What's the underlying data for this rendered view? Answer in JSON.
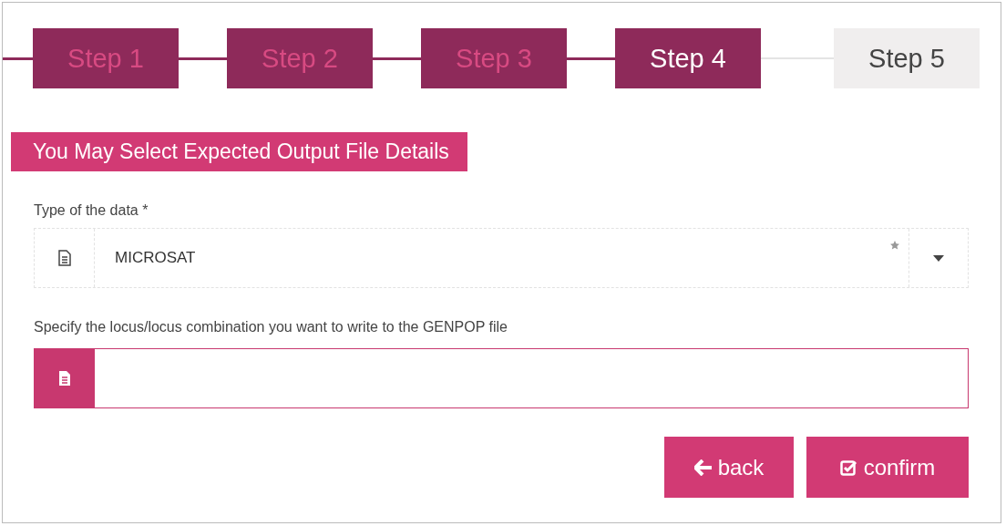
{
  "steps": [
    {
      "label": "Step 1",
      "done": true,
      "selected": false
    },
    {
      "label": "Step 2",
      "done": true,
      "selected": false
    },
    {
      "label": "Step 3",
      "done": true,
      "selected": false
    },
    {
      "label": "Step 4",
      "done": false,
      "selected": true
    },
    {
      "label": "Step 5",
      "done": false,
      "selected": false
    }
  ],
  "section_title": "You May Select Expected Output File Details",
  "data_type": {
    "label": "Type of the data *",
    "value": "MICROSAT"
  },
  "locus": {
    "label": "Specify the locus/locus combination you want to write to the GENPOP file"
  },
  "buttons": [
    {
      "kind": "back",
      "label": "back"
    },
    {
      "kind": "confirm",
      "label": "confirm"
    }
  ]
}
